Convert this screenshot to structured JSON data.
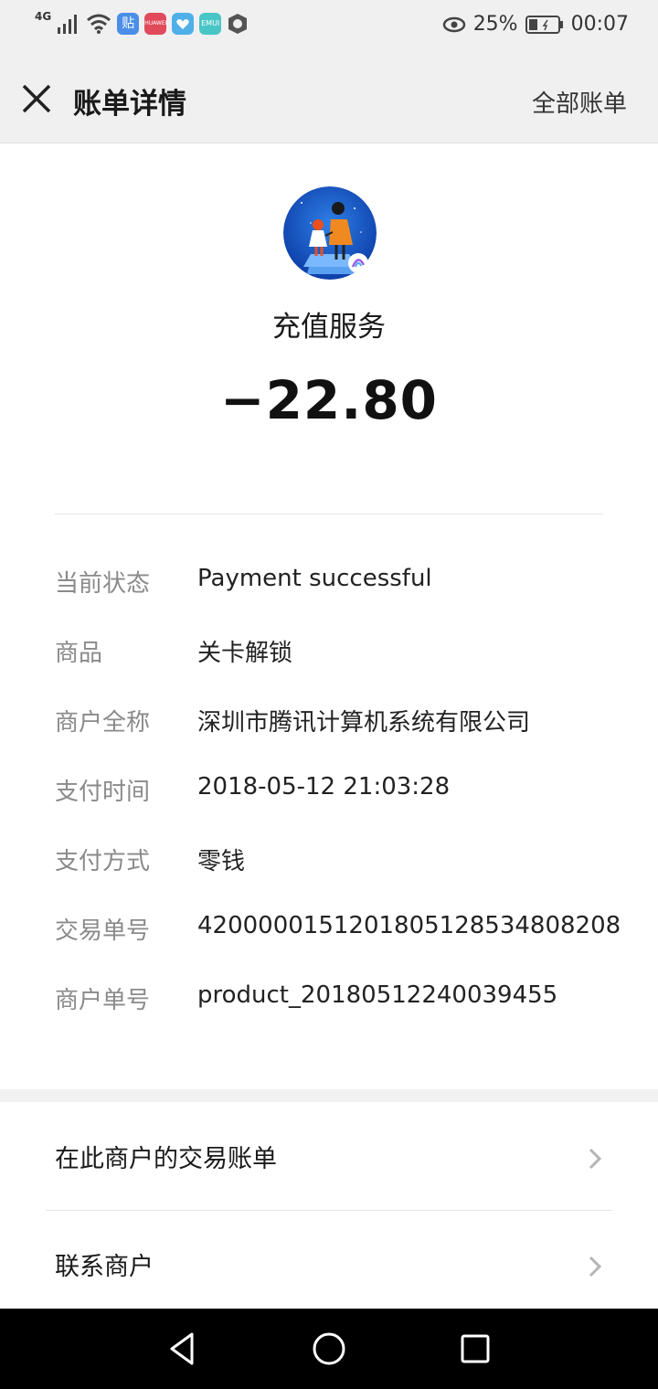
{
  "status_bar": {
    "network": "4G",
    "battery_percent": "25%",
    "time": "00:07",
    "app_badges": [
      "贴",
      "HUAWEI",
      "EMUI"
    ],
    "icons": [
      "signal-icon",
      "wifi-icon",
      "tieba-app-icon",
      "huawei-app-icon",
      "heart-app-icon",
      "emui-app-icon",
      "shield-app-icon",
      "eye-icon",
      "battery-icon"
    ]
  },
  "header": {
    "title": "账单详情",
    "right_link": "全部账单",
    "close_icon": "close-icon"
  },
  "merchant": {
    "name": "充值服务",
    "amount": "−22.80",
    "logo_icon": "merchant-logo-avatar"
  },
  "details": [
    {
      "label": "当前状态",
      "value": "Payment successful"
    },
    {
      "label": "商品",
      "value": "关卡解锁"
    },
    {
      "label": "商户全称",
      "value": "深圳市腾讯计算机系统有限公司"
    },
    {
      "label": "支付时间",
      "value": "2018-05-12 21:03:28"
    },
    {
      "label": "支付方式",
      "value": "零钱"
    },
    {
      "label": "交易单号",
      "value": "4200000151201805128534808208"
    },
    {
      "label": "商户单号",
      "value": "product_20180512240039455"
    }
  ],
  "links": [
    {
      "label": "在此商户的交易账单",
      "icon": "chevron-right-icon"
    },
    {
      "label": "联系商户",
      "icon": "chevron-right-icon"
    }
  ],
  "nav": {
    "icons": [
      "back-triangle-icon",
      "home-circle-icon",
      "recents-square-icon"
    ]
  },
  "colors": {
    "header_bg": "#f0f0f0",
    "label_gray": "#8a8a8a",
    "nav_bg": "#000000"
  }
}
